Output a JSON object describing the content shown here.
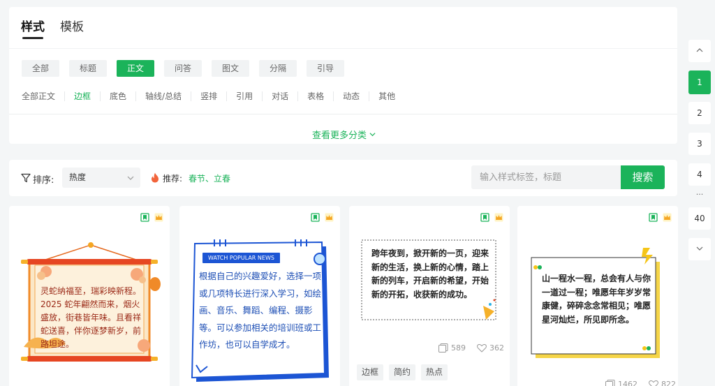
{
  "tabs": [
    {
      "label": "样式",
      "active": true
    },
    {
      "label": "模板",
      "active": false
    }
  ],
  "categories": [
    {
      "label": "全部",
      "active": false
    },
    {
      "label": "标题",
      "active": false
    },
    {
      "label": "正文",
      "active": true
    },
    {
      "label": "问答",
      "active": false
    },
    {
      "label": "图文",
      "active": false
    },
    {
      "label": "分隔",
      "active": false
    },
    {
      "label": "引导",
      "active": false
    }
  ],
  "subcategories": [
    {
      "label": "全部正文",
      "active": false
    },
    {
      "label": "边框",
      "active": true
    },
    {
      "label": "底色",
      "active": false
    },
    {
      "label": "轴线/总结",
      "active": false
    },
    {
      "label": "竖排",
      "active": false
    },
    {
      "label": "引用",
      "active": false
    },
    {
      "label": "对话",
      "active": false
    },
    {
      "label": "表格",
      "active": false
    },
    {
      "label": "动态",
      "active": false
    },
    {
      "label": "其他",
      "active": false
    }
  ],
  "more_link": "查看更多分类",
  "filter": {
    "sort_label": "排序:",
    "sort_value": "热度",
    "hot_label": "推荐:",
    "hot_links": [
      "春节",
      "立春"
    ],
    "hot_separator": "、",
    "search_placeholder": "输入样式标签，标题",
    "search_button": "搜索"
  },
  "cards": [
    {
      "text": "灵蛇纳福至，瑞彩映新程。2025 蛇年翩然而来，烟火盛放，街巷皆年味。且看祥蛇送喜，伴你逐梦新岁，前路坦途。"
    },
    {
      "badge": "WATCH POPULAR NEWS",
      "text": "根据自己的兴趣爱好，选择一项或几项特长进行深入学习，如绘画、音乐、舞蹈、编程、摄影等。可以参加相关的培训班或工作坊，也可以自学成才。"
    },
    {
      "text": "跨年夜到，掀开新的一页，迎来新的生活，换上新的心情，踏上新的列车，开启新的希望，开始新的开拓，收获新的成功。",
      "copies": "589",
      "likes": "362",
      "tags": [
        "边框",
        "简约",
        "热点"
      ]
    },
    {
      "text": "山一程水一程，总会有人与你一道过一程；唯愿年年岁岁常康健，碎碎念念常相见；唯愿星河灿烂，所见即所念。",
      "copies": "1462",
      "likes": "822"
    }
  ],
  "pagination": {
    "pages": [
      "1",
      "2",
      "3",
      "4"
    ],
    "active": "1",
    "ellipsis": "...",
    "last": "40"
  },
  "colors": {
    "accent": "#1bb35a",
    "card2_blue": "#1c55d4",
    "card1_red": "#9b2a18",
    "card4_yellow": "#f5c518"
  }
}
